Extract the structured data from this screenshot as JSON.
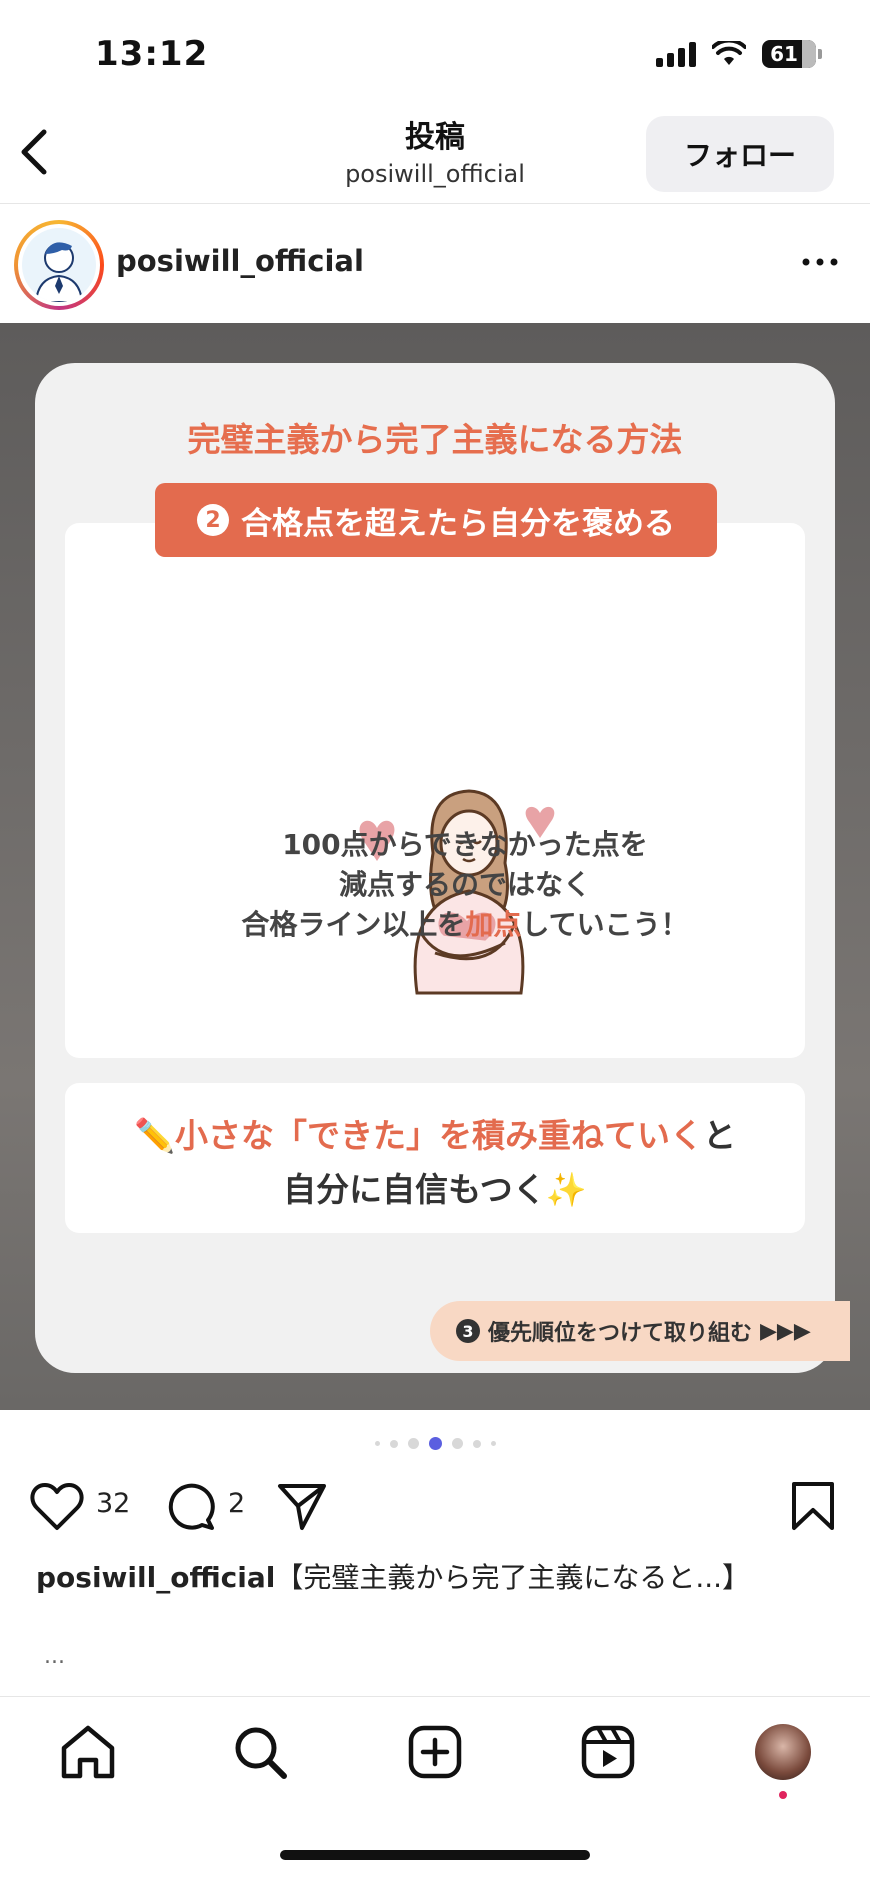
{
  "status_bar": {
    "time": "13:12",
    "battery": "61"
  },
  "header": {
    "title": "投稿",
    "subtitle": "posiwill_official",
    "follow_label": "フォロー"
  },
  "post": {
    "username": "posiwill_official",
    "slide": {
      "title": "完璧主義から完了主義になる方法",
      "step_number": "2",
      "step_label": "合格点を超えたら自分を褒める",
      "desc_line1": "100点からできなかった点を",
      "desc_line2": "減点するのではなく",
      "desc_line3_pre": "合格ライン以上を",
      "desc_line3_hl": "加点",
      "desc_line3_post": "していこう！",
      "tip_icon": "✏️",
      "tip_hl": "小さな「できた」を積み重ねていく",
      "tip_post": "と",
      "tip_line2": "自分に自信もつく",
      "tip_sparkle": "✨",
      "next_number": "3",
      "next_label": "優先順位をつけて取り組む",
      "next_arrows": "▶▶▶"
    },
    "carousel": {
      "total": 7,
      "active": 4
    },
    "likes": "32",
    "comments": "2",
    "caption_user": "posiwill_official",
    "caption_text": "【完璧主義から完了主義になると...】",
    "ellipsis": "..."
  },
  "colors": {
    "accent": "#e36b4e",
    "dot_active": "#5b5fe0"
  },
  "tabbar": {
    "items": [
      "home-icon",
      "search-icon",
      "create-icon",
      "reels-icon",
      "profile-avatar"
    ]
  }
}
